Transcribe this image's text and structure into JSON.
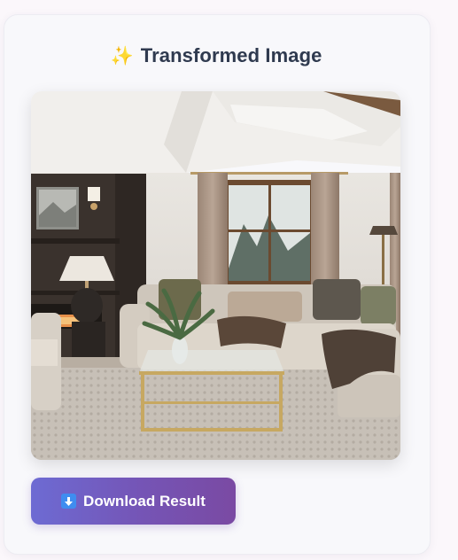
{
  "card": {
    "title": "Transformed Image",
    "title_icon": "sparkle-icon"
  },
  "result_image": {
    "icon": "living-room-photo"
  },
  "download": {
    "label": "Download Result",
    "icon": "download-arrow-icon",
    "icon_color": "#3f8df0"
  },
  "colors": {
    "button_gradient_start": "#6d6bd3",
    "button_gradient_end": "#7a4aa3",
    "title_text": "#2f3a4f"
  }
}
